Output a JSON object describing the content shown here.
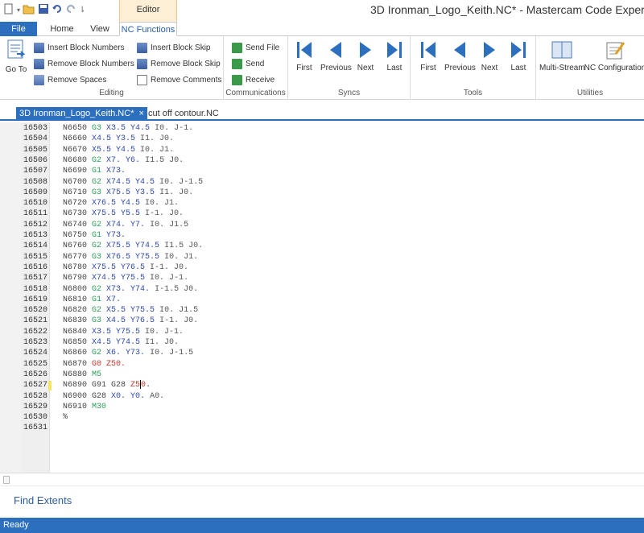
{
  "window": {
    "title": "3D Ironman_Logo_Keith.NC* - Mastercam Code Expert",
    "context_tab_label": "Editor"
  },
  "ribbon_tabs": {
    "file": "File",
    "home": "Home",
    "view": "View",
    "nc_functions": "NC Functions"
  },
  "groups": {
    "editing": {
      "label": "Editing",
      "goto": "Go To",
      "insert_block_numbers": "Insert Block Numbers",
      "remove_block_numbers": "Remove Block Numbers",
      "remove_spaces": "Remove Spaces",
      "insert_block_skip": "Insert Block Skip",
      "remove_block_skip": "Remove Block Skip",
      "remove_comments": "Remove Comments"
    },
    "communications": {
      "label": "Communications",
      "send_file": "Send File",
      "send": "Send",
      "receive": "Receive"
    },
    "syncs": {
      "label": "Syncs",
      "first": "First",
      "previous": "Previous",
      "next": "Next",
      "last": "Last"
    },
    "tools": {
      "label": "Tools",
      "first": "First",
      "previous": "Previous",
      "next": "Next",
      "last": "Last"
    },
    "utilities": {
      "label": "Utilities",
      "multi_stream": "Multi-Stream",
      "nc_configuration": "NC Configuration"
    }
  },
  "doc_tabs": [
    {
      "label": "3D Ironman_Logo_Keith.NC*",
      "close": "×"
    },
    {
      "label": "cut off contour.NC"
    }
  ],
  "colors": {
    "accent": "#2c6fbf",
    "g_code": "#2e9e58",
    "x_y": "#2f4aa8",
    "ij": "#555555",
    "rapid": "#c23a2a",
    "m_code": "#2e9e58"
  },
  "code_lines": [
    {
      "num": "16503",
      "tokens": [
        {
          "t": "N6650 ",
          "c": "n"
        },
        {
          "t": "G3 ",
          "c": "g"
        },
        {
          "t": "X3.5 ",
          "c": "x"
        },
        {
          "t": "Y4.5 ",
          "c": "x"
        },
        {
          "t": "I0. J-1.",
          "c": "i"
        }
      ]
    },
    {
      "num": "16504",
      "tokens": [
        {
          "t": "N6660 ",
          "c": "n"
        },
        {
          "t": "X4.5 ",
          "c": "x"
        },
        {
          "t": "Y3.5 ",
          "c": "x"
        },
        {
          "t": "I1. J0.",
          "c": "i"
        }
      ]
    },
    {
      "num": "16505",
      "tokens": [
        {
          "t": "N6670 ",
          "c": "n"
        },
        {
          "t": "X5.5 ",
          "c": "x"
        },
        {
          "t": "Y4.5 ",
          "c": "x"
        },
        {
          "t": "I0. J1.",
          "c": "i"
        }
      ]
    },
    {
      "num": "16506",
      "tokens": [
        {
          "t": "N6680 ",
          "c": "n"
        },
        {
          "t": "G2 ",
          "c": "g"
        },
        {
          "t": "X7. ",
          "c": "x"
        },
        {
          "t": "Y6. ",
          "c": "x"
        },
        {
          "t": "I1.5 J0.",
          "c": "i"
        }
      ]
    },
    {
      "num": "16507",
      "tokens": [
        {
          "t": "N6690 ",
          "c": "n"
        },
        {
          "t": "G1 ",
          "c": "g"
        },
        {
          "t": "X73.",
          "c": "x"
        }
      ]
    },
    {
      "num": "16508",
      "tokens": [
        {
          "t": "N6700 ",
          "c": "n"
        },
        {
          "t": "G2 ",
          "c": "g"
        },
        {
          "t": "X74.5 ",
          "c": "x"
        },
        {
          "t": "Y4.5 ",
          "c": "x"
        },
        {
          "t": "I0. J-1.5",
          "c": "i"
        }
      ]
    },
    {
      "num": "16509",
      "tokens": [
        {
          "t": "N6710 ",
          "c": "n"
        },
        {
          "t": "G3 ",
          "c": "g"
        },
        {
          "t": "X75.5 ",
          "c": "x"
        },
        {
          "t": "Y3.5 ",
          "c": "x"
        },
        {
          "t": "I1. J0.",
          "c": "i"
        }
      ]
    },
    {
      "num": "16510",
      "tokens": [
        {
          "t": "N6720 ",
          "c": "n"
        },
        {
          "t": "X76.5 ",
          "c": "x"
        },
        {
          "t": "Y4.5 ",
          "c": "x"
        },
        {
          "t": "I0. J1.",
          "c": "i"
        }
      ]
    },
    {
      "num": "16511",
      "tokens": [
        {
          "t": "N6730 ",
          "c": "n"
        },
        {
          "t": "X75.5 ",
          "c": "x"
        },
        {
          "t": "Y5.5 ",
          "c": "x"
        },
        {
          "t": "I-1. J0.",
          "c": "i"
        }
      ]
    },
    {
      "num": "16512",
      "tokens": [
        {
          "t": "N6740 ",
          "c": "n"
        },
        {
          "t": "G2 ",
          "c": "g"
        },
        {
          "t": "X74. ",
          "c": "x"
        },
        {
          "t": "Y7. ",
          "c": "x"
        },
        {
          "t": "I0. J1.5",
          "c": "i"
        }
      ]
    },
    {
      "num": "16513",
      "tokens": [
        {
          "t": "N6750 ",
          "c": "n"
        },
        {
          "t": "G1 ",
          "c": "g"
        },
        {
          "t": "Y73.",
          "c": "x"
        }
      ]
    },
    {
      "num": "16514",
      "tokens": [
        {
          "t": "N6760 ",
          "c": "n"
        },
        {
          "t": "G2 ",
          "c": "g"
        },
        {
          "t": "X75.5 ",
          "c": "x"
        },
        {
          "t": "Y74.5 ",
          "c": "x"
        },
        {
          "t": "I1.5 J0.",
          "c": "i"
        }
      ]
    },
    {
      "num": "16515",
      "tokens": [
        {
          "t": "N6770 ",
          "c": "n"
        },
        {
          "t": "G3 ",
          "c": "g"
        },
        {
          "t": "X76.5 ",
          "c": "x"
        },
        {
          "t": "Y75.5 ",
          "c": "x"
        },
        {
          "t": "I0. J1.",
          "c": "i"
        }
      ]
    },
    {
      "num": "16516",
      "tokens": [
        {
          "t": "N6780 ",
          "c": "n"
        },
        {
          "t": "X75.5 ",
          "c": "x"
        },
        {
          "t": "Y76.5 ",
          "c": "x"
        },
        {
          "t": "I-1. J0.",
          "c": "i"
        }
      ]
    },
    {
      "num": "16517",
      "tokens": [
        {
          "t": "N6790 ",
          "c": "n"
        },
        {
          "t": "X74.5 ",
          "c": "x"
        },
        {
          "t": "Y75.5 ",
          "c": "x"
        },
        {
          "t": "I0. J-1.",
          "c": "i"
        }
      ]
    },
    {
      "num": "16518",
      "tokens": [
        {
          "t": "N6800 ",
          "c": "n"
        },
        {
          "t": "G2 ",
          "c": "g"
        },
        {
          "t": "X73. ",
          "c": "x"
        },
        {
          "t": "Y74. ",
          "c": "x"
        },
        {
          "t": "I-1.5 J0.",
          "c": "i"
        }
      ]
    },
    {
      "num": "16519",
      "tokens": [
        {
          "t": "N6810 ",
          "c": "n"
        },
        {
          "t": "G1 ",
          "c": "g"
        },
        {
          "t": "X7.",
          "c": "x"
        }
      ]
    },
    {
      "num": "16520",
      "tokens": [
        {
          "t": "N6820 ",
          "c": "n"
        },
        {
          "t": "G2 ",
          "c": "g"
        },
        {
          "t": "X5.5 ",
          "c": "x"
        },
        {
          "t": "Y75.5 ",
          "c": "x"
        },
        {
          "t": "I0. J1.5",
          "c": "i"
        }
      ]
    },
    {
      "num": "16521",
      "tokens": [
        {
          "t": "N6830 ",
          "c": "n"
        },
        {
          "t": "G3 ",
          "c": "g"
        },
        {
          "t": "X4.5 ",
          "c": "x"
        },
        {
          "t": "Y76.5 ",
          "c": "x"
        },
        {
          "t": "I-1. J0.",
          "c": "i"
        }
      ]
    },
    {
      "num": "16522",
      "tokens": [
        {
          "t": "N6840 ",
          "c": "n"
        },
        {
          "t": "X3.5 ",
          "c": "x"
        },
        {
          "t": "Y75.5 ",
          "c": "x"
        },
        {
          "t": "I0. J-1.",
          "c": "i"
        }
      ]
    },
    {
      "num": "16523",
      "tokens": [
        {
          "t": "N6850 ",
          "c": "n"
        },
        {
          "t": "X4.5 ",
          "c": "x"
        },
        {
          "t": "Y74.5 ",
          "c": "x"
        },
        {
          "t": "I1. J0.",
          "c": "i"
        }
      ]
    },
    {
      "num": "16524",
      "tokens": [
        {
          "t": "N6860 ",
          "c": "n"
        },
        {
          "t": "G2 ",
          "c": "g"
        },
        {
          "t": "X6. ",
          "c": "x"
        },
        {
          "t": "Y73. ",
          "c": "x"
        },
        {
          "t": "I0. J-1.5",
          "c": "i"
        }
      ]
    },
    {
      "num": "16525",
      "tokens": [
        {
          "t": "N6870 ",
          "c": "n"
        },
        {
          "t": "G0 ",
          "c": "r"
        },
        {
          "t": "Z50.",
          "c": "r"
        }
      ]
    },
    {
      "num": "16526",
      "tokens": [
        {
          "t": "N6880 ",
          "c": "n"
        },
        {
          "t": "M5",
          "c": "g"
        }
      ]
    },
    {
      "num": "16527",
      "tokens": [
        {
          "t": "N6890 ",
          "c": "n"
        },
        {
          "t": "G91 G28 ",
          "c": "n"
        },
        {
          "t": "Z5",
          "c": "r"
        },
        {
          "t": "|",
          "c": "cursor"
        },
        {
          "t": "0",
          "c": "r"
        },
        {
          "t": ".",
          "c": "n"
        }
      ],
      "marked": true
    },
    {
      "num": "16528",
      "tokens": [
        {
          "t": "N6900 ",
          "c": "n"
        },
        {
          "t": "G28 ",
          "c": "n"
        },
        {
          "t": "X0. ",
          "c": "x"
        },
        {
          "t": "Y0. ",
          "c": "x"
        },
        {
          "t": "A0.",
          "c": "i"
        }
      ]
    },
    {
      "num": "16529",
      "tokens": [
        {
          "t": "N6910 ",
          "c": "n"
        },
        {
          "t": "M30",
          "c": "g"
        }
      ]
    },
    {
      "num": "16530",
      "tokens": [
        {
          "t": "%",
          "c": "n"
        }
      ]
    },
    {
      "num": "16531",
      "tokens": []
    }
  ],
  "bottom": {
    "find_extents": "Find Extents"
  },
  "status": {
    "text": "Ready"
  },
  "icons": [
    "new-icon",
    "open-icon",
    "save-icon",
    "undo-icon",
    "redo-icon",
    "goto-icon",
    "insert-block-numbers-icon",
    "remove-block-numbers-icon",
    "remove-spaces-icon",
    "insert-block-skip-icon",
    "remove-block-skip-icon",
    "remove-comments-icon",
    "send-file-icon",
    "send-icon",
    "receive-icon",
    "first-icon",
    "previous-icon",
    "next-icon",
    "last-icon",
    "multi-stream-icon",
    "nc-configuration-icon"
  ]
}
